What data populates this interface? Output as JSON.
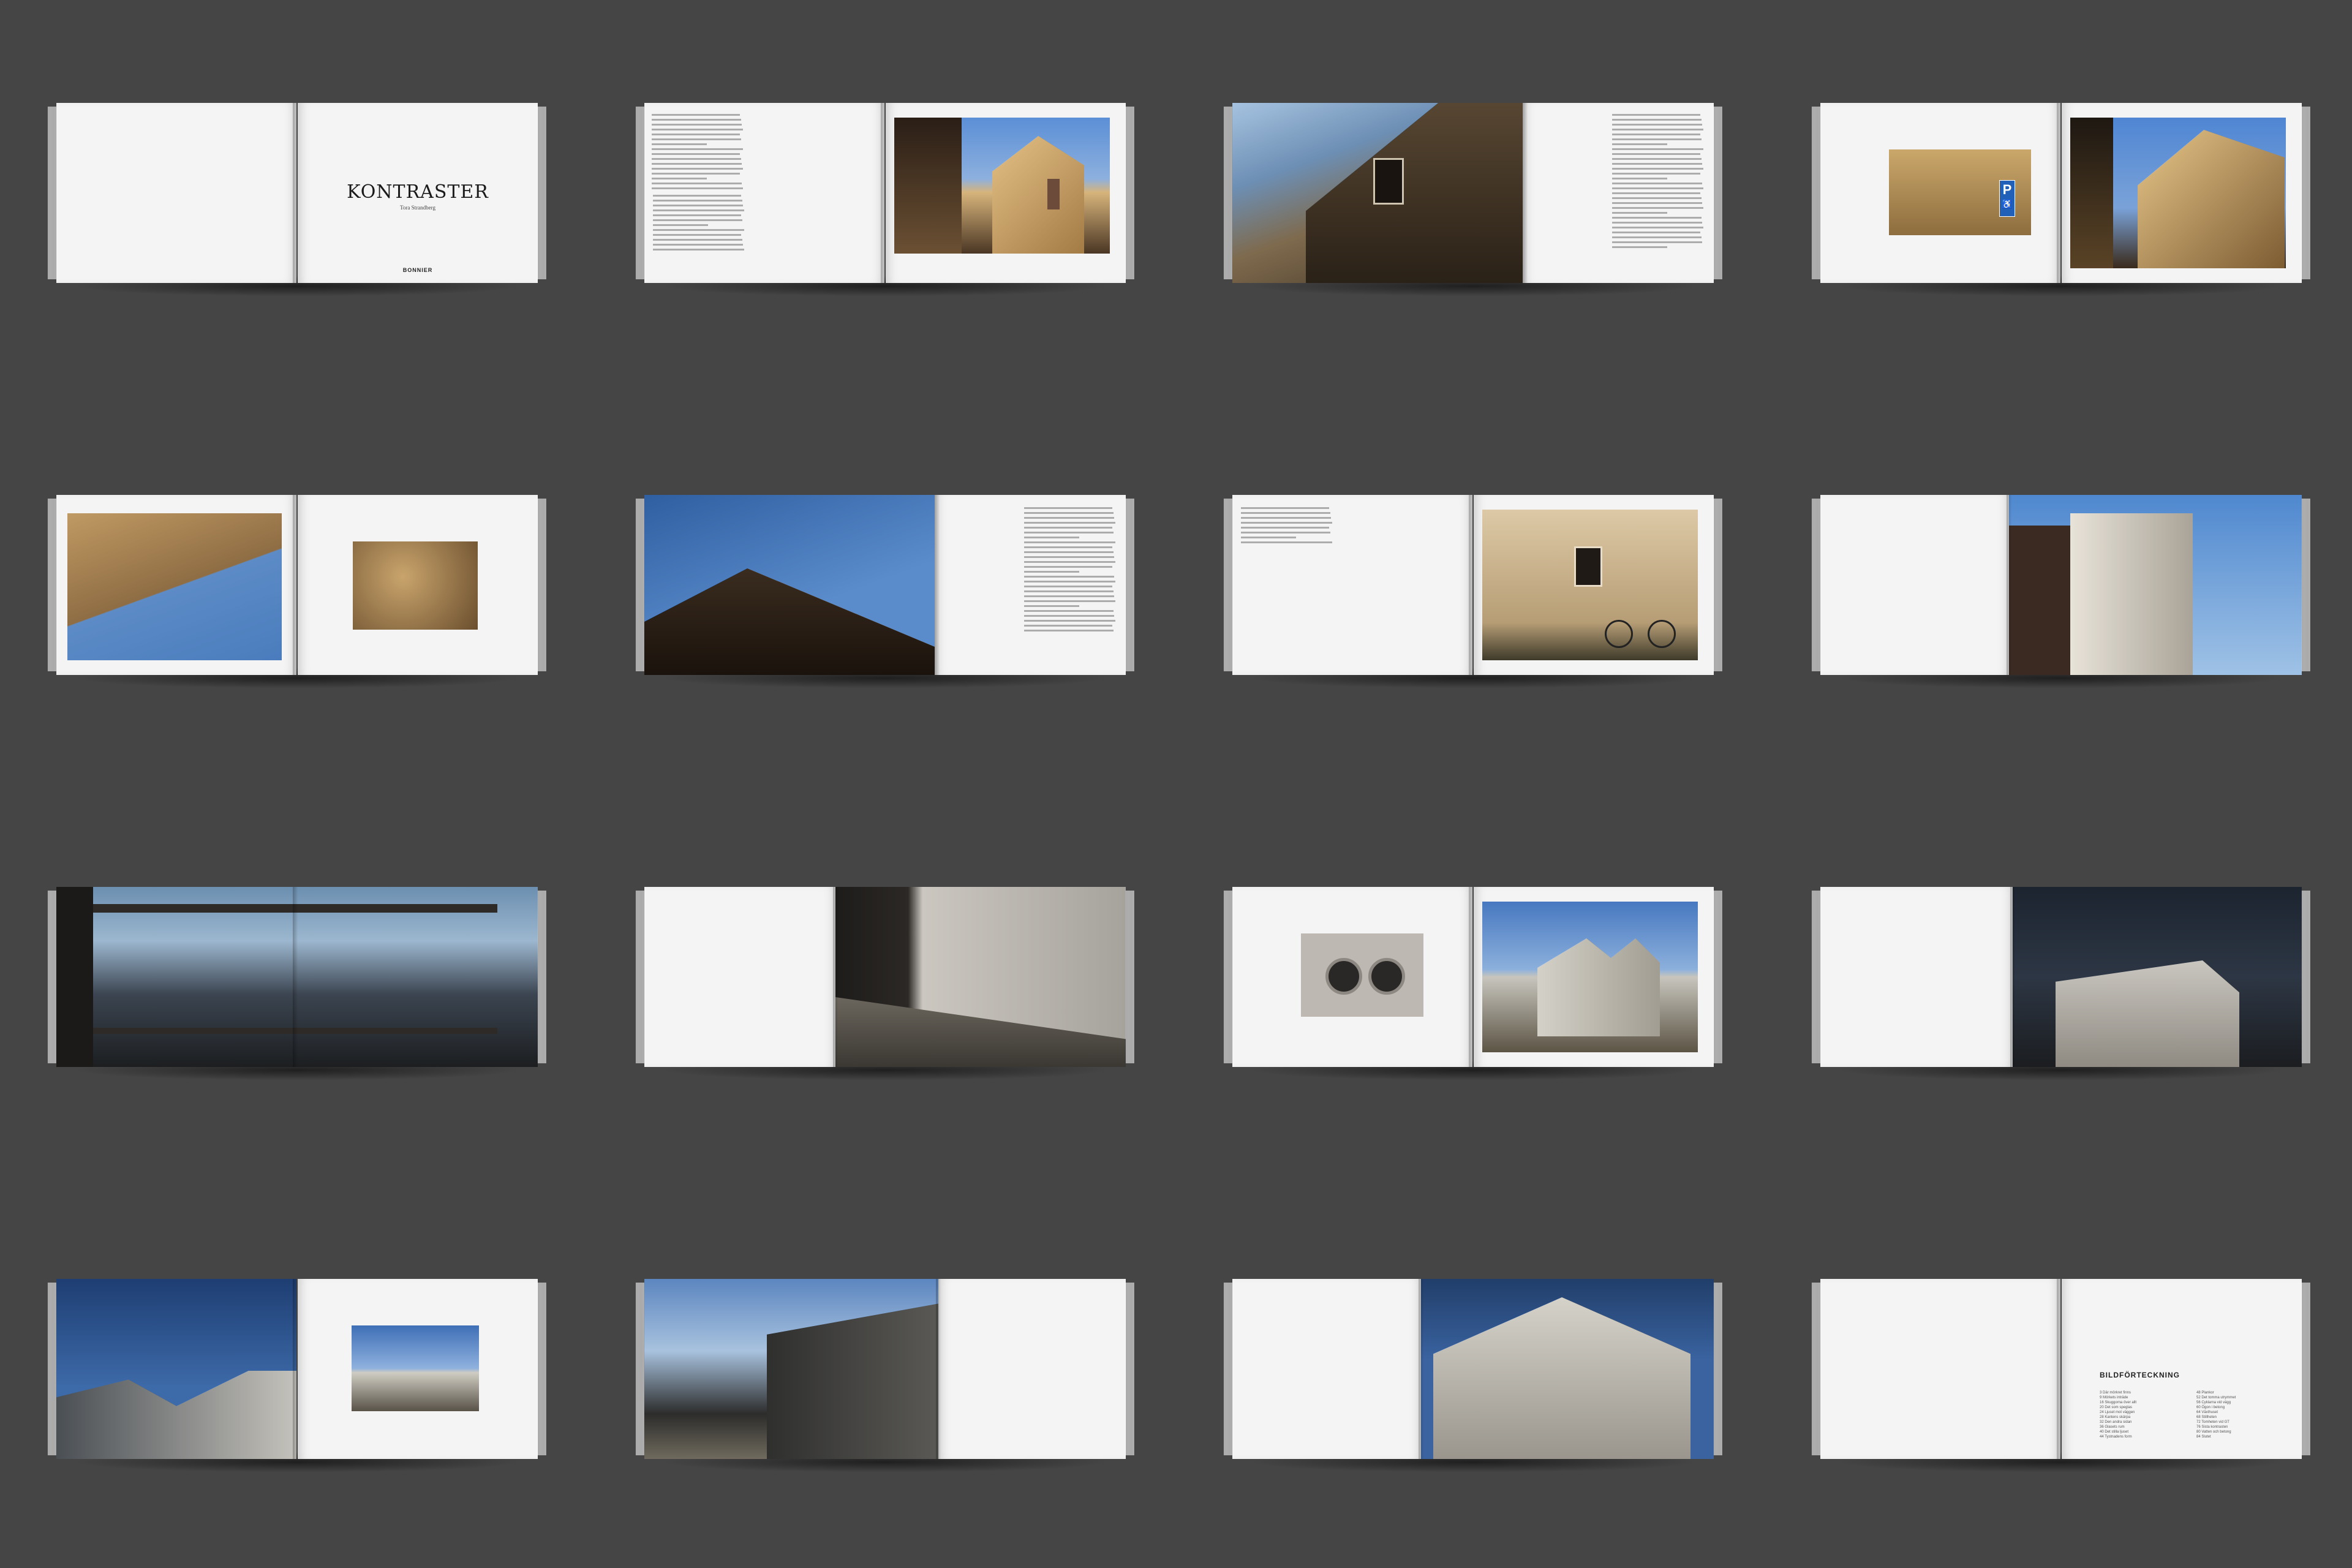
{
  "book": {
    "title": "KONTRASTER",
    "author": "Tora Strandberg",
    "publisher": "BONNIER",
    "toc_title": "BILDFÖRTECKNING",
    "toc_left": [
      "3   Där mörkret finns",
      "9   Mörkets inträde",
      "16  Skuggorna över allt",
      "20  Det som speglas",
      "24  Ljuset mot väggen",
      "28  Kantens skärpa",
      "32  Den andra sidan",
      "36  Glasets rum",
      "40  Det stilla ljuset",
      "44  Tystnadens form"
    ],
    "toc_right": [
      "48  Plankor",
      "52  Det tomma utrymmet",
      "56  Cyklarna vid vägg",
      "60  Ögon i betong",
      "64  Växthuset",
      "68  Stillheten",
      "72  Tomheten vid GT",
      "76  Sista kontrasten",
      "80  Vatten och betong",
      "84  Slutet"
    ],
    "sign_letter": "P"
  },
  "colors": {
    "background": "#454545",
    "page": "#f4f4f4",
    "sky": "#4a7fb8",
    "facade": "#c9a56e",
    "concrete": "#b8b4ab"
  }
}
